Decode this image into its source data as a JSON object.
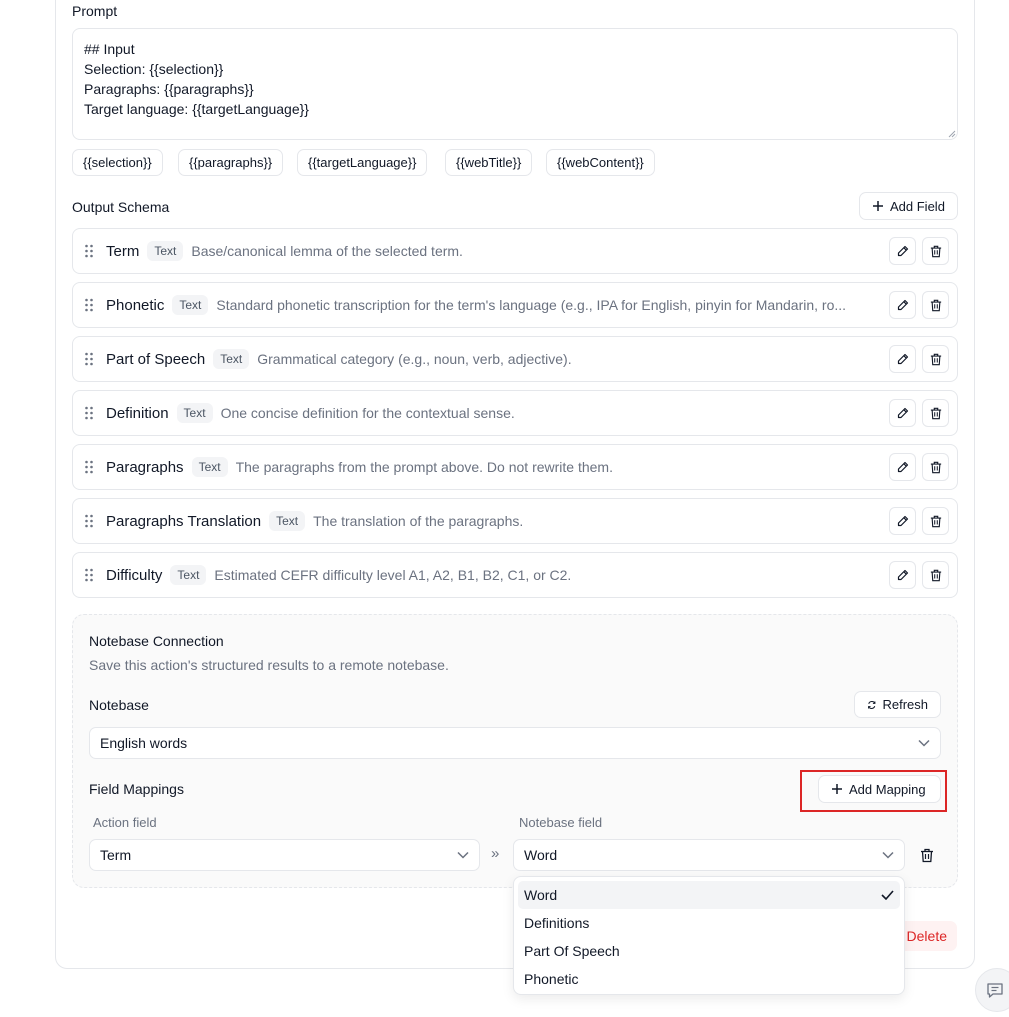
{
  "prompt": {
    "label": "Prompt",
    "value": "## Input\nSelection: {{selection}}\nParagraphs: {{paragraphs}}\nTarget language: {{targetLanguage}}"
  },
  "variables": [
    "{{selection}}",
    "{{paragraphs}}",
    "{{targetLanguage}}",
    "{{webTitle}}",
    "{{webContent}}"
  ],
  "output_schema": {
    "label": "Output Schema",
    "add_field_label": "Add Field",
    "fields": [
      {
        "name": "Term",
        "type": "Text",
        "description": "Base/canonical lemma of the selected term."
      },
      {
        "name": "Phonetic",
        "type": "Text",
        "description": "Standard phonetic transcription for the term's language (e.g., IPA for English, pinyin for Mandarin, ro..."
      },
      {
        "name": "Part of Speech",
        "type": "Text",
        "description": "Grammatical category (e.g., noun, verb, adjective)."
      },
      {
        "name": "Definition",
        "type": "Text",
        "description": "One concise definition for the contextual sense."
      },
      {
        "name": "Paragraphs",
        "type": "Text",
        "description": "The paragraphs from the prompt above. Do not rewrite them."
      },
      {
        "name": "Paragraphs Translation",
        "type": "Text",
        "description": "The translation of the paragraphs."
      },
      {
        "name": "Difficulty",
        "type": "Text",
        "description": "Estimated CEFR difficulty level A1, A2, B1, B2, C1, or C2."
      }
    ]
  },
  "notebase": {
    "title": "Notebase Connection",
    "subtitle": "Save this action's structured results to a remote notebase.",
    "notebase_label": "Notebase",
    "refresh_label": "Refresh",
    "selected_notebase": "English words",
    "field_mappings_label": "Field Mappings",
    "add_mapping_label": "Add Mapping",
    "action_field_header": "Action field",
    "notebase_field_header": "Notebase field",
    "mapping": {
      "action_field": "Term",
      "arrow": "»",
      "notebase_field": "Word"
    }
  },
  "dropdown": {
    "options": [
      "Word",
      "Definitions",
      "Part Of Speech",
      "Phonetic"
    ],
    "selected": "Word"
  },
  "delete_label": "Delete",
  "colors": {
    "accent_red": "#dc2626",
    "border": "#e5e7eb",
    "muted_text": "#6b7280"
  }
}
